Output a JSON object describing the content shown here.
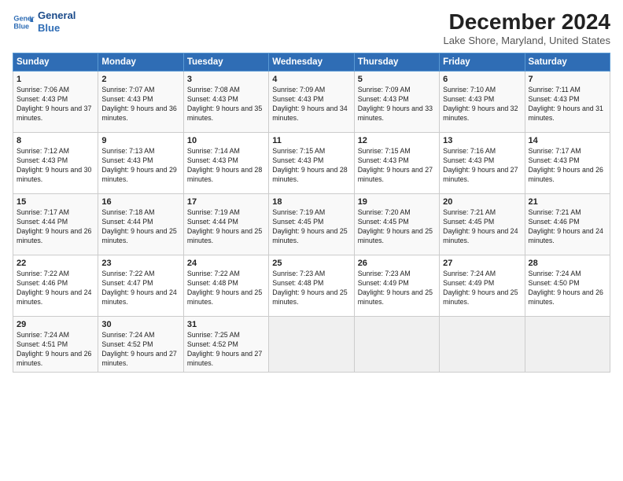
{
  "logo": {
    "line1": "General",
    "line2": "Blue"
  },
  "title": "December 2024",
  "subtitle": "Lake Shore, Maryland, United States",
  "headers": [
    "Sunday",
    "Monday",
    "Tuesday",
    "Wednesday",
    "Thursday",
    "Friday",
    "Saturday"
  ],
  "weeks": [
    [
      {
        "day": "1",
        "sunrise": "7:06 AM",
        "sunset": "4:43 PM",
        "daylight": "9 hours and 37 minutes."
      },
      {
        "day": "2",
        "sunrise": "7:07 AM",
        "sunset": "4:43 PM",
        "daylight": "9 hours and 36 minutes."
      },
      {
        "day": "3",
        "sunrise": "7:08 AM",
        "sunset": "4:43 PM",
        "daylight": "9 hours and 35 minutes."
      },
      {
        "day": "4",
        "sunrise": "7:09 AM",
        "sunset": "4:43 PM",
        "daylight": "9 hours and 34 minutes."
      },
      {
        "day": "5",
        "sunrise": "7:09 AM",
        "sunset": "4:43 PM",
        "daylight": "9 hours and 33 minutes."
      },
      {
        "day": "6",
        "sunrise": "7:10 AM",
        "sunset": "4:43 PM",
        "daylight": "9 hours and 32 minutes."
      },
      {
        "day": "7",
        "sunrise": "7:11 AM",
        "sunset": "4:43 PM",
        "daylight": "9 hours and 31 minutes."
      }
    ],
    [
      {
        "day": "8",
        "sunrise": "7:12 AM",
        "sunset": "4:43 PM",
        "daylight": "9 hours and 30 minutes."
      },
      {
        "day": "9",
        "sunrise": "7:13 AM",
        "sunset": "4:43 PM",
        "daylight": "9 hours and 29 minutes."
      },
      {
        "day": "10",
        "sunrise": "7:14 AM",
        "sunset": "4:43 PM",
        "daylight": "9 hours and 28 minutes."
      },
      {
        "day": "11",
        "sunrise": "7:15 AM",
        "sunset": "4:43 PM",
        "daylight": "9 hours and 28 minutes."
      },
      {
        "day": "12",
        "sunrise": "7:15 AM",
        "sunset": "4:43 PM",
        "daylight": "9 hours and 27 minutes."
      },
      {
        "day": "13",
        "sunrise": "7:16 AM",
        "sunset": "4:43 PM",
        "daylight": "9 hours and 27 minutes."
      },
      {
        "day": "14",
        "sunrise": "7:17 AM",
        "sunset": "4:43 PM",
        "daylight": "9 hours and 26 minutes."
      }
    ],
    [
      {
        "day": "15",
        "sunrise": "7:17 AM",
        "sunset": "4:44 PM",
        "daylight": "9 hours and 26 minutes."
      },
      {
        "day": "16",
        "sunrise": "7:18 AM",
        "sunset": "4:44 PM",
        "daylight": "9 hours and 25 minutes."
      },
      {
        "day": "17",
        "sunrise": "7:19 AM",
        "sunset": "4:44 PM",
        "daylight": "9 hours and 25 minutes."
      },
      {
        "day": "18",
        "sunrise": "7:19 AM",
        "sunset": "4:45 PM",
        "daylight": "9 hours and 25 minutes."
      },
      {
        "day": "19",
        "sunrise": "7:20 AM",
        "sunset": "4:45 PM",
        "daylight": "9 hours and 25 minutes."
      },
      {
        "day": "20",
        "sunrise": "7:21 AM",
        "sunset": "4:45 PM",
        "daylight": "9 hours and 24 minutes."
      },
      {
        "day": "21",
        "sunrise": "7:21 AM",
        "sunset": "4:46 PM",
        "daylight": "9 hours and 24 minutes."
      }
    ],
    [
      {
        "day": "22",
        "sunrise": "7:22 AM",
        "sunset": "4:46 PM",
        "daylight": "9 hours and 24 minutes."
      },
      {
        "day": "23",
        "sunrise": "7:22 AM",
        "sunset": "4:47 PM",
        "daylight": "9 hours and 24 minutes."
      },
      {
        "day": "24",
        "sunrise": "7:22 AM",
        "sunset": "4:48 PM",
        "daylight": "9 hours and 25 minutes."
      },
      {
        "day": "25",
        "sunrise": "7:23 AM",
        "sunset": "4:48 PM",
        "daylight": "9 hours and 25 minutes."
      },
      {
        "day": "26",
        "sunrise": "7:23 AM",
        "sunset": "4:49 PM",
        "daylight": "9 hours and 25 minutes."
      },
      {
        "day": "27",
        "sunrise": "7:24 AM",
        "sunset": "4:49 PM",
        "daylight": "9 hours and 25 minutes."
      },
      {
        "day": "28",
        "sunrise": "7:24 AM",
        "sunset": "4:50 PM",
        "daylight": "9 hours and 26 minutes."
      }
    ],
    [
      {
        "day": "29",
        "sunrise": "7:24 AM",
        "sunset": "4:51 PM",
        "daylight": "9 hours and 26 minutes."
      },
      {
        "day": "30",
        "sunrise": "7:24 AM",
        "sunset": "4:52 PM",
        "daylight": "9 hours and 27 minutes."
      },
      {
        "day": "31",
        "sunrise": "7:25 AM",
        "sunset": "4:52 PM",
        "daylight": "9 hours and 27 minutes."
      },
      null,
      null,
      null,
      null
    ]
  ]
}
